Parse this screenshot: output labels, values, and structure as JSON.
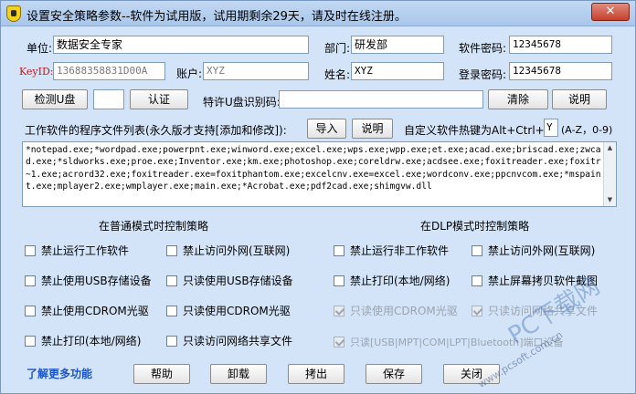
{
  "title": "设置安全策略参数--软件为试用版，试用期剩余29天，请及时在线注册。",
  "close_label": "✕",
  "form": {
    "unit_label": "单位:",
    "unit_value": "数据安全专家",
    "dept_label": "部门:",
    "dept_value": "研发部",
    "softpwd_label": "软件密码:",
    "softpwd_value": "12345678",
    "keyid_label": "KeyID:",
    "keyid_value": "13688358831D00A",
    "account_label": "账户:",
    "account_value": "XYZ",
    "name_label": "姓名:",
    "name_value": "XYZ",
    "loginpwd_label": "登录密码:",
    "loginpwd_value": "12345678"
  },
  "usb": {
    "detect_label": "检测U盘",
    "verify_label": "认证",
    "special_label": "特许U盘识别码:",
    "special_value": "",
    "clear_label": "清除",
    "help_label": "说明"
  },
  "programs": {
    "label": "工作软件的程序文件列表(永久版才支持[添加和修改]):",
    "import_label": "导入",
    "help_label": "说明",
    "hotkey_label": "自定义软件热键为Alt+Ctrl+",
    "hotkey_value": "Y",
    "hotkey_range": "(A-Z，0-9)",
    "list_text": "*notepad.exe;*wordpad.exe;powerpnt.exe;winword.exe;excel.exe;wps.exe;wpp.exe;et.exe;acad.exe;briscad.exe;zwcad.exe;*sldworks.exe;proe.exe;Inventor.exe;km.exe;photoshop.exe;coreldrw.exe;acdsee.exe;foxitreader.exe;foxitr~1.exe;acrord32.exe;foxitreader.exe=foxitphantom.exe;excelcnv.exe=excel.exe;wordconv.exe;ppcnvcom.exe;*mspaint.exe;mplayer2.exe;wmplayer.exe;main.exe;*Acrobat.exe;pdf2cad.exe;shimgvw.dll"
  },
  "normal_mode": {
    "title": "在普通模式时控制策略",
    "items": [
      "禁止运行工作软件",
      "禁止访问外网(互联网)",
      "禁止使用USB存储设备",
      "只读使用USB存储设备",
      "禁止使用CDROM光驱",
      "只读使用CDROM光驱",
      "禁止打印(本地/网络)",
      "只读访问网络共享文件"
    ]
  },
  "dlp_mode": {
    "title": "在DLP模式时控制策略",
    "items": [
      "禁止运行非工作软件",
      "禁止访问外网(互联网)",
      "禁止打印(本地/网络)",
      "禁止屏幕拷贝软件截图",
      "只读使用CDROM光驱",
      "只读访问网络共享文件",
      "只读[USB|MPT|COM|LPT|Bluetooth]端口设备"
    ]
  },
  "footer": {
    "more_link": "了解更多功能",
    "buttons": [
      "帮助",
      "卸载",
      "拷出",
      "保存",
      "关闭"
    ]
  },
  "watermark": {
    "logo": "PC下载网",
    "url": "www.pcsoft.com.cn"
  }
}
